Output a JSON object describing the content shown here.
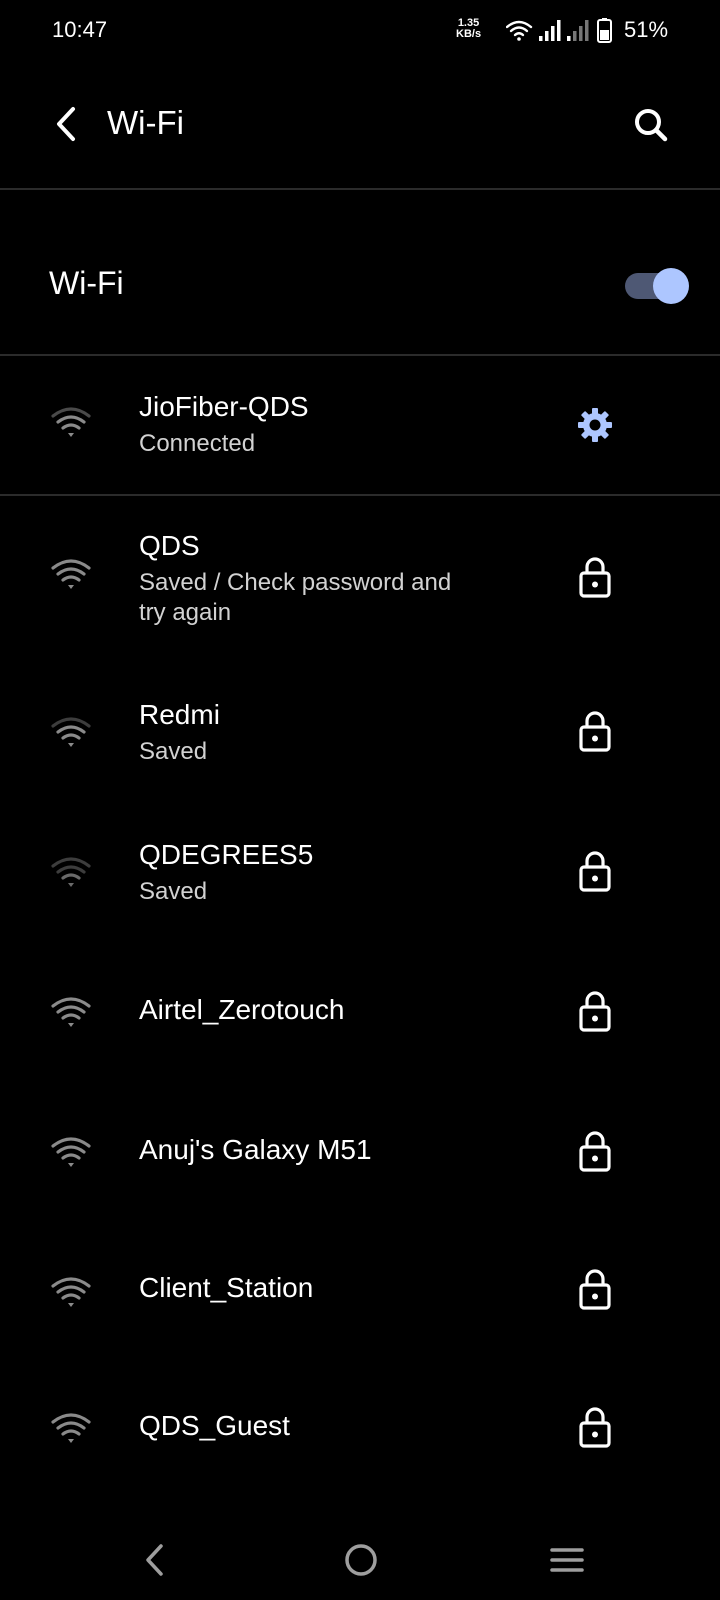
{
  "status_bar": {
    "time": "10:47",
    "speed_value": "1.35",
    "speed_unit": "KB/s",
    "battery_percent": "51%"
  },
  "app_bar": {
    "title": "Wi-Fi"
  },
  "wifi_toggle": {
    "label": "Wi-Fi",
    "state": "on"
  },
  "connected_network": {
    "name": "JioFiber-QDS",
    "status": "Connected"
  },
  "networks": [
    {
      "name": "QDS",
      "status": "Saved / Check password and try again",
      "locked": true,
      "signal": 4
    },
    {
      "name": "Redmi",
      "status": "Saved",
      "locked": true,
      "signal": 3
    },
    {
      "name": "QDEGREES5",
      "status": "Saved",
      "locked": true,
      "signal": 2
    },
    {
      "name": "Airtel_Zerotouch",
      "status": "",
      "locked": true,
      "signal": 4
    },
    {
      "name": "Anuj's Galaxy M51",
      "status": "",
      "locked": true,
      "signal": 4
    },
    {
      "name": "Client_Station",
      "status": "",
      "locked": true,
      "signal": 4
    },
    {
      "name": "QDS_Guest",
      "status": "",
      "locked": true,
      "signal": 4
    }
  ],
  "colors": {
    "background": "#000000",
    "accent": "#adc6ff",
    "toggle_track": "#4e5874",
    "divider": "#2b2b2b",
    "icon_gray": "#9a9a9a"
  }
}
